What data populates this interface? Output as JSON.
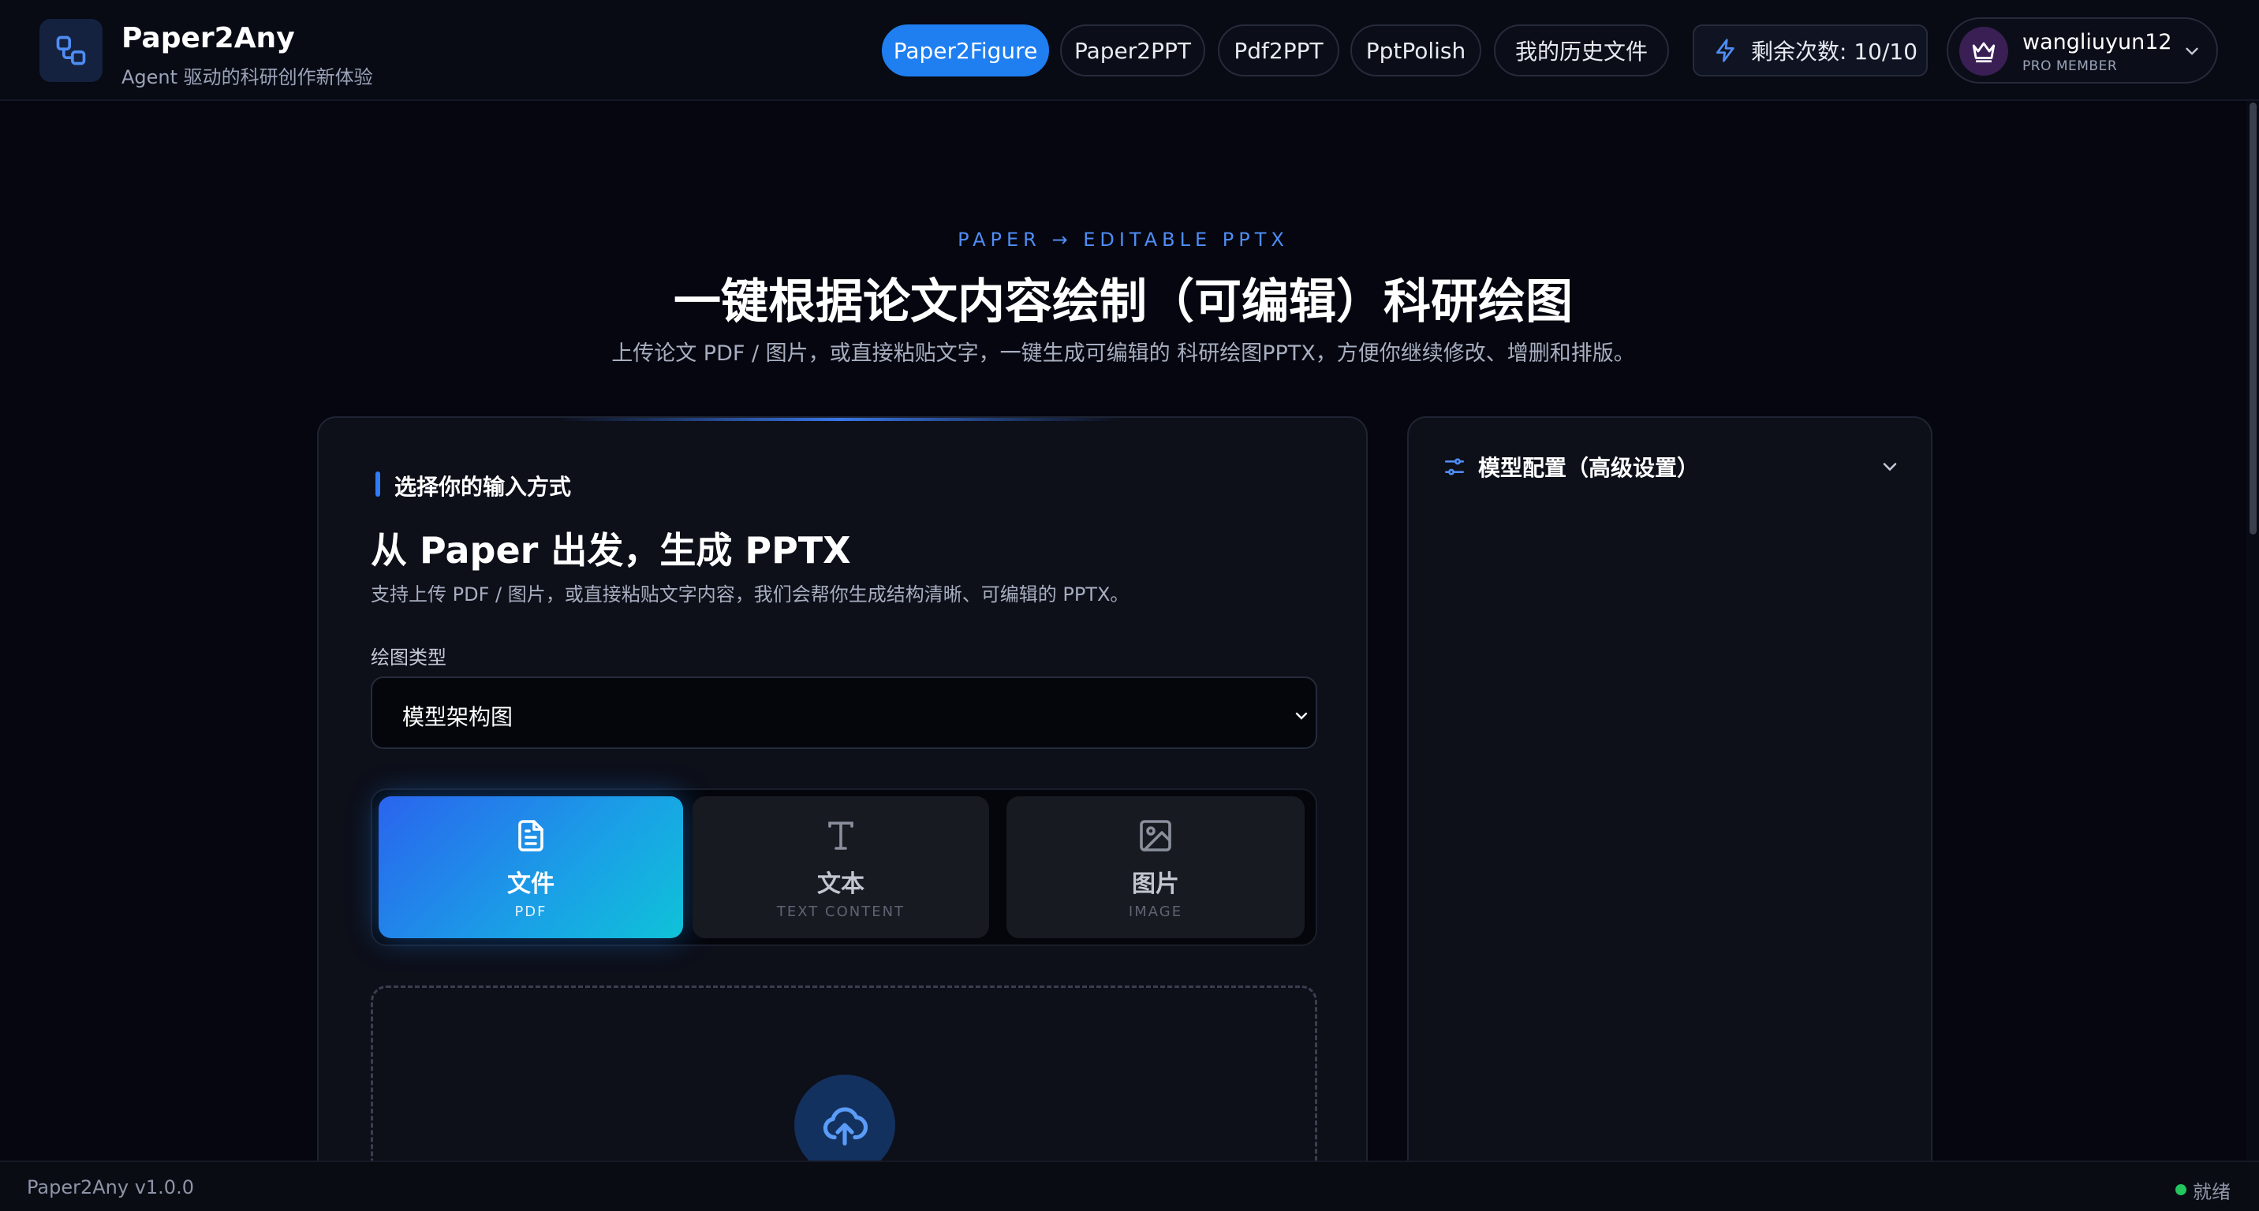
{
  "header": {
    "brand_title": "Paper2Any",
    "brand_subtitle": "Agent 驱动的科研创作新体验",
    "nav": [
      {
        "label": "Paper2Figure",
        "active": true
      },
      {
        "label": "Paper2PPT",
        "active": false
      },
      {
        "label": "Pdf2PPT",
        "active": false
      },
      {
        "label": "PptPolish",
        "active": false
      },
      {
        "label": "我的历史文件",
        "active": false
      }
    ],
    "quota_label": "剩余次数: 10/10",
    "user": {
      "name": "wangliuyun12",
      "role": "PRO MEMBER"
    }
  },
  "hero": {
    "eyebrow": "PAPER → EDITABLE PPTX",
    "title": "一键根据论文内容绘制（可编辑）科研绘图",
    "subtitle": "上传论文 PDF / 图片，或直接粘贴文字，一键生成可编辑的 科研绘图PPTX，方便你继续修改、增删和排版。"
  },
  "input_card": {
    "section_label": "选择你的输入方式",
    "title": "从 Paper 出发，生成 PPTX",
    "description": "支持上传 PDF / 图片，或直接粘贴文字内容，我们会帮你生成结构清晰、可编辑的 PPTX。",
    "figure_type_label": "绘图类型",
    "figure_type_value": "模型架构图",
    "modes": [
      {
        "label": "文件",
        "sub": "PDF",
        "icon": "file-text-icon",
        "active": true
      },
      {
        "label": "文本",
        "sub": "TEXT CONTENT",
        "icon": "text-icon",
        "active": false
      },
      {
        "label": "图片",
        "sub": "IMAGE",
        "icon": "image-icon",
        "active": false
      }
    ]
  },
  "config_card": {
    "label": "模型配置（高级设置）"
  },
  "statusbar": {
    "version": "Paper2Any v1.0.0",
    "status": "就绪"
  },
  "colors": {
    "accent": "#1f7ff0",
    "background": "#05060f",
    "card": "#0d0f19",
    "status_ok": "#22c55e"
  }
}
